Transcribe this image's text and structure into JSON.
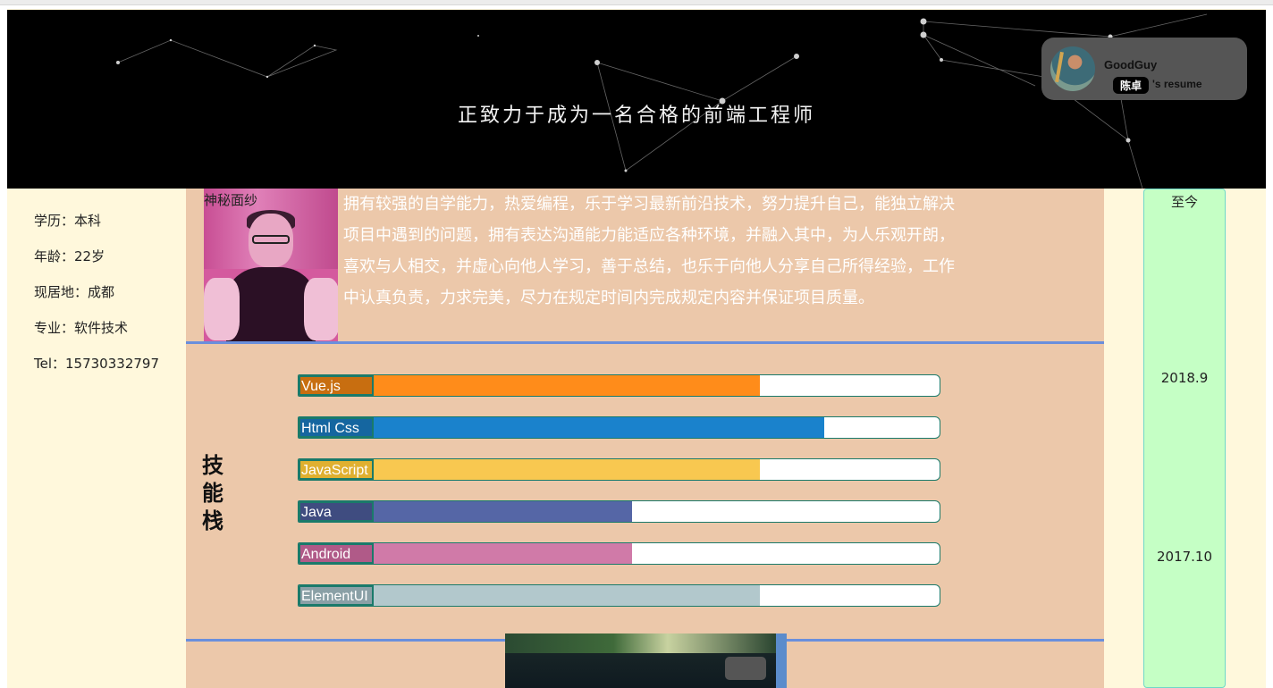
{
  "banner": {
    "title": "正致力于成为一名合格的前端工程师"
  },
  "user_card": {
    "name": "GoodGuy",
    "tag": "陈卓",
    "suffix": "'s resume"
  },
  "personal_info": [
    "学历：本科",
    "年龄：22岁",
    "现居地：成都",
    "专业：软件技术",
    "Tel：15730332797"
  ],
  "intro": {
    "photo_caption": "神秘面纱",
    "text": "拥有较强的自学能力，热爱编程，乐于学习最新前沿技术，努力提升自己，能独立解决项目中遇到的问题，拥有表达沟通能力能适应各种环境，并融入其中，为人乐观开朗，喜欢与人相交，并虚心向他人学习，善于总结，也乐于向他人分享自己所得经验，工作中认真负责，力求完美，尽力在规定时间内完成规定内容并保证项目质量。"
  },
  "skills": {
    "title": "技能栈",
    "items": [
      {
        "label": "Vue.js",
        "level": 0.72,
        "fill_color": "#ff8c1a",
        "label_bg": "#c86e10"
      },
      {
        "label": "Html Css",
        "level": 0.82,
        "fill_color": "#1a82cc",
        "label_bg": "#1566a0"
      },
      {
        "label": "JavaScript",
        "level": 0.72,
        "fill_color": "#f8c850",
        "label_bg": "#e0b030"
      },
      {
        "label": "Java",
        "level": 0.52,
        "fill_color": "#5566a6",
        "label_bg": "#3f4c80"
      },
      {
        "label": "Android",
        "level": 0.52,
        "fill_color": "#d07aa8",
        "label_bg": "#b05a88"
      },
      {
        "label": "ElementUI",
        "level": 0.72,
        "fill_color": "#b2c8cc",
        "label_bg": "#8aa0a6"
      }
    ]
  },
  "timeline": [
    "至今",
    "2018.9",
    "2017.10"
  ]
}
